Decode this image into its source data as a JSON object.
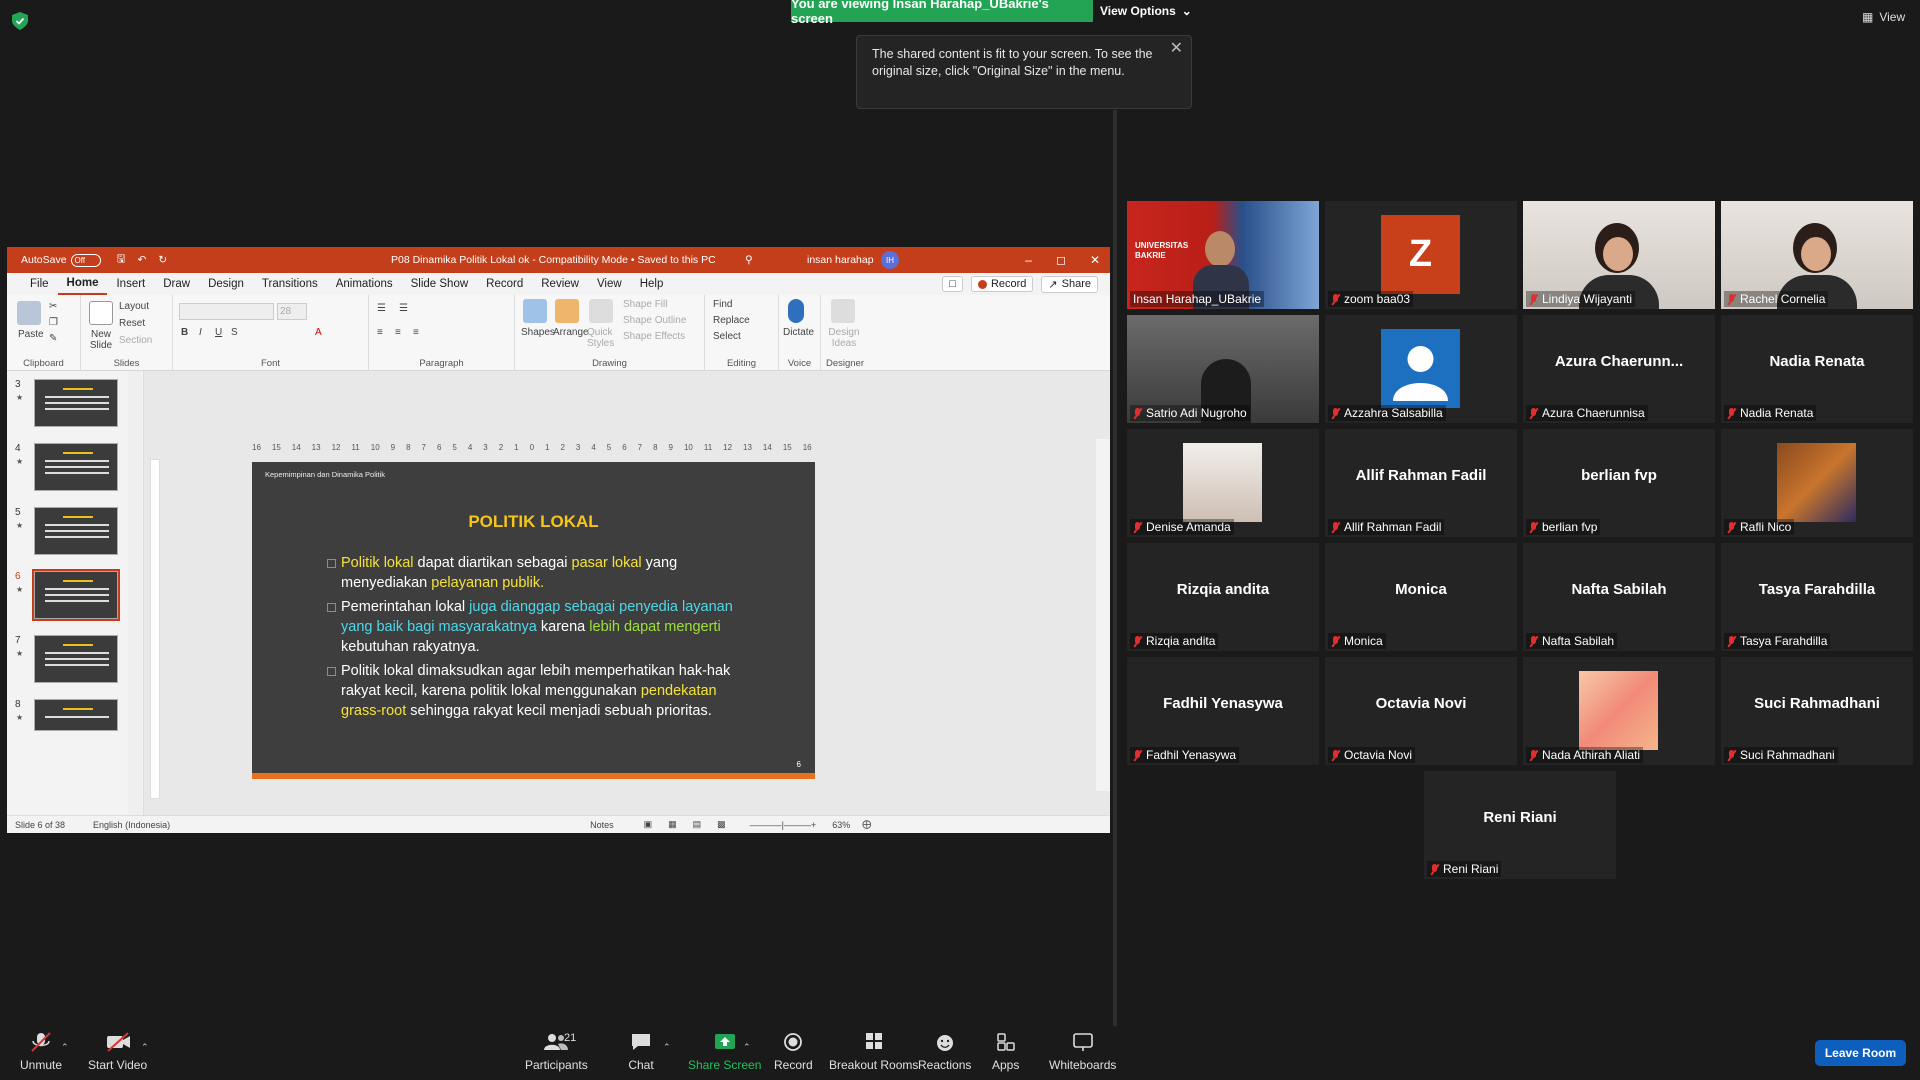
{
  "zoom": {
    "banner": "You are viewing Insan Harahap_UBakrie's screen",
    "view_options": "View Options",
    "top_view": "View",
    "tooltip": "The shared content is fit to your screen. To see the original size, click \"Original Size\" in the menu.",
    "participants_count": "21",
    "toolbar": {
      "unmute": "Unmute",
      "start_video": "Start Video",
      "participants": "Participants",
      "chat": "Chat",
      "share_screen": "Share Screen",
      "record": "Record",
      "breakout_rooms": "Breakout Rooms",
      "reactions": "Reactions",
      "apps": "Apps",
      "whiteboards": "Whiteboards",
      "leave_room": "Leave Room"
    },
    "tiles": [
      {
        "name": "Insan Harahap_UBakrie",
        "kind": "video-host"
      },
      {
        "name": "zoom baa03",
        "kind": "letter",
        "letter": "Z"
      },
      {
        "name": "Lindiya Wijayanti",
        "kind": "video"
      },
      {
        "name": "Rachel Cornelia",
        "kind": "video"
      },
      {
        "name": "Satrio Adi Nugroho",
        "kind": "video"
      },
      {
        "name": "Azzahra Salsabilla",
        "kind": "avatar"
      },
      {
        "name": "Azura Chaerunnisa",
        "kind": "text",
        "display": "Azura  Chaerunn..."
      },
      {
        "name": "Nadia Renata",
        "kind": "text",
        "display": "Nadia Renata"
      },
      {
        "name": "Denise Amanda",
        "kind": "photo"
      },
      {
        "name": "Allif Rahman Fadil",
        "kind": "text",
        "display": "Allif Rahman Fadil"
      },
      {
        "name": "berlian fvp",
        "kind": "text",
        "display": "berlian fvp"
      },
      {
        "name": "Rafli Nico",
        "kind": "photo"
      },
      {
        "name": "Rizqia andita",
        "kind": "text",
        "display": "Rizqia andita"
      },
      {
        "name": "Monica",
        "kind": "text",
        "display": "Monica"
      },
      {
        "name": "Nafta Sabilah",
        "kind": "text",
        "display": "Nafta Sabilah"
      },
      {
        "name": "Tasya Farahdilla",
        "kind": "text",
        "display": "Tasya Farahdilla"
      },
      {
        "name": "Fadhil Yenasywa",
        "kind": "text",
        "display": "Fadhil Yenasywa"
      },
      {
        "name": "Octavia Novi",
        "kind": "text",
        "display": "Octavia Novi"
      },
      {
        "name": "Nada Athirah Aliati",
        "kind": "photo"
      },
      {
        "name": "Suci Rahmadhani",
        "kind": "text",
        "display": "Suci Rahmadhani"
      },
      {
        "name": "Reni Riani",
        "kind": "text",
        "display": "Reni Riani"
      }
    ],
    "host_tile_brand": "UNIVERSITAS BAKRIE"
  },
  "ppt": {
    "autosave": "AutoSave",
    "autosave_state": "Off",
    "doc_title": "P08 Dinamika Politik Lokal ok  -  Compatibility Mode • Saved to this PC",
    "user": "insan harahap",
    "user_initials": "IH",
    "tabs": [
      "File",
      "Home",
      "Insert",
      "Draw",
      "Design",
      "Transitions",
      "Animations",
      "Slide Show",
      "Record",
      "Review",
      "View",
      "Help"
    ],
    "record_btn": "Record",
    "share_btn": "Share",
    "ribbon": {
      "paste": "Paste",
      "clipboard": "Clipboard",
      "new_slide": "New Slide",
      "layout": "Layout",
      "reset": "Reset",
      "section": "Section",
      "slides": "Slides",
      "font_size": "28",
      "font": "Font",
      "paragraph": "Paragraph",
      "shapes": "Shapes",
      "arrange": "Arrange",
      "quick_styles": "Quick Styles",
      "shape_fill": "Shape Fill",
      "shape_outline": "Shape Outline",
      "shape_effects": "Shape Effects",
      "drawing": "Drawing",
      "find": "Find",
      "replace": "Replace",
      "select": "Select",
      "editing": "Editing",
      "dictate": "Dictate",
      "voice": "Voice",
      "design_ideas": "Design Ideas",
      "designer": "Designer"
    },
    "thumbs": [
      "3",
      "4",
      "5",
      "6",
      "7",
      "8"
    ],
    "active_thumb": "6",
    "ruler_ticks": [
      "16",
      "15",
      "14",
      "13",
      "12",
      "11",
      "10",
      "9",
      "8",
      "7",
      "6",
      "5",
      "4",
      "3",
      "2",
      "1",
      "0",
      "1",
      "2",
      "3",
      "4",
      "5",
      "6",
      "7",
      "8",
      "9",
      "10",
      "11",
      "12",
      "13",
      "14",
      "15",
      "16"
    ],
    "slide": {
      "header": "Kepemimpinan dan Dinamika Politik",
      "title": "POLITIK LOKAL",
      "b1": {
        "a": "Politik lokal",
        "b": " dapat diartikan sebagai ",
        "c": "pasar lokal",
        "d": " yang menyediakan ",
        "e": "pelayanan publik."
      },
      "b2": {
        "a": "Pemerintahan lokal ",
        "b": "juga dianggap sebagai penyedia layanan yang baik bagi masyarakatnya",
        "c": " karena ",
        "d": "lebih dapat mengerti",
        "e": " kebutuhan rakyatnya."
      },
      "b3": {
        "a": "Politik lokal dimaksudkan  agar lebih memperhatikan hak-hak rakyat kecil, karena politik lokal menggunakan ",
        "b": "pendekatan grass-root",
        "c": " sehingga rakyat kecil menjadi sebuah prioritas."
      },
      "page_number": "6"
    },
    "status": {
      "slide_of": "Slide 6 of 38",
      "language": "English (Indonesia)",
      "notes": "Notes",
      "zoom": "63%"
    }
  }
}
